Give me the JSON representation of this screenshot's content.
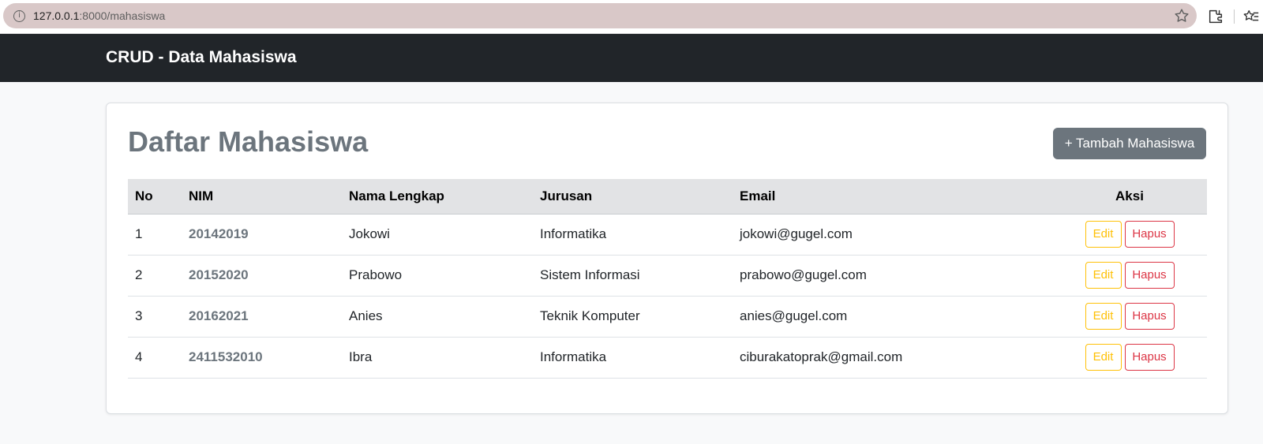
{
  "browser": {
    "url_host": "127.0.0.1",
    "url_path": ":8000/mahasiswa",
    "icons": [
      "info-icon",
      "bookmark-star-icon",
      "extensions-icon",
      "favorites-icon"
    ]
  },
  "navbar": {
    "brand": "CRUD - Data Mahasiswa"
  },
  "main": {
    "title": "Daftar Mahasiswa",
    "add_button": "+ Tambah Mahasiswa",
    "table": {
      "headers": [
        "No",
        "NIM",
        "Nama Lengkap",
        "Jurusan",
        "Email",
        "Aksi"
      ],
      "rows": [
        {
          "no": "1",
          "nim": "20142019",
          "nama": "Jokowi",
          "jurusan": "Informatika",
          "email": "jokowi@gugel.com"
        },
        {
          "no": "2",
          "nim": "20152020",
          "nama": "Prabowo",
          "jurusan": "Sistem Informasi",
          "email": "prabowo@gugel.com"
        },
        {
          "no": "3",
          "nim": "20162021",
          "nama": "Anies",
          "jurusan": "Teknik Komputer",
          "email": "anies@gugel.com"
        },
        {
          "no": "4",
          "nim": "2411532010",
          "nama": "Ibra",
          "jurusan": "Informatika",
          "email": "ciburakatoprak@gmail.com"
        }
      ],
      "edit_label": "Edit",
      "delete_label": "Hapus"
    }
  },
  "colors": {
    "navbar_bg": "#212529",
    "secondary": "#6c757d",
    "warning": "#ffc107",
    "danger": "#dc3545",
    "header_bg": "#e2e3e5"
  }
}
